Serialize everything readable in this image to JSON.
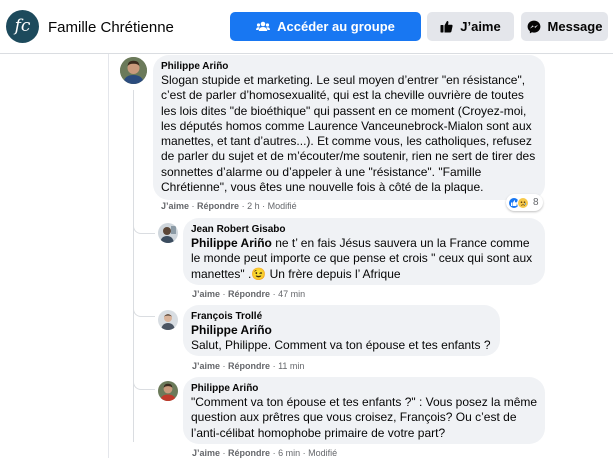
{
  "header": {
    "page_name": "Famille Chrétienne",
    "logo_text": "fc",
    "join_button": "Accéder au groupe",
    "like_button": "J’aime",
    "message_button": "Message"
  },
  "comments": [
    {
      "author": "Philippe Ariño",
      "text": "Slogan stupide et marketing. Le seul moyen d’entrer \"en résistance\", c’est de parler d’homosexualité, qui est la cheville ouvrière de toutes les lois dites \"de bioéthique\" qui passent en ce moment (Croyez-moi, les députés homos comme Laurence Vanceunebrock-Mialon sont aux manettes, et tant d’autres...). Et comme vous, les catholiques, refusez de parler du sujet et de m’écouter/me soutenir, rien ne sert de tirer des sonnettes d’alarme ou d’appeler à une \"résistance\". \"Famille Chrétienne\", vous êtes une nouvelle fois à côté de la plaque.",
      "like": "J’aime",
      "reply": "Répondre",
      "time": "2 h",
      "edited": "Modifié",
      "reaction_count": "8",
      "reaction_icons": [
        "like-icon",
        "sad-icon"
      ]
    }
  ],
  "replies": [
    {
      "author": "Jean Robert Gisabo",
      "mention": "Philippe Ariño",
      "text": " ne t’ en fais Jésus sauvera un la France comme le monde peut importe ce que pense et crois \" ceux qui sont aux manettes\" .",
      "emoji": "😉",
      "text_after": " Un frère depuis l’ Afrique",
      "like": "J’aime",
      "reply": "Répondre",
      "time": "47 min"
    },
    {
      "author": "François Trollé",
      "mention": "Philippe Ariño",
      "text": "Salut, Philippe. Comment va ton épouse et tes enfants ?",
      "like": "J’aime",
      "reply": "Répondre",
      "time": "11 min"
    },
    {
      "author": "Philippe Ariño",
      "text": "\"Comment va ton épouse et tes enfants ?\" : Vous posez la même question aux prêtres que vous croisez, François? Ou c’est de l’anti-célibat homophobe primaire de votre part?",
      "like": "J’aime",
      "reply": "Répondre",
      "time": "6 min",
      "edited": "Modifié"
    }
  ],
  "colors": {
    "accent": "#1877f2",
    "bubble": "#f0f2f5",
    "secondary_text": "#65676b",
    "logo_bg": "#1d4a5c"
  }
}
